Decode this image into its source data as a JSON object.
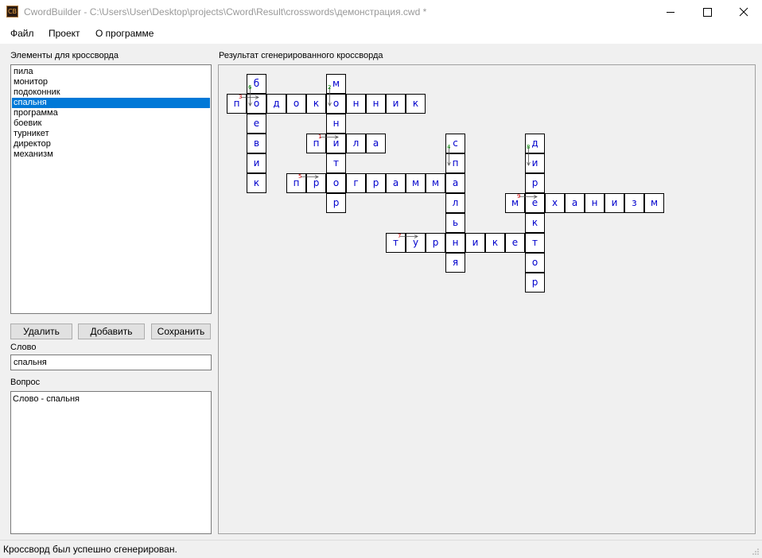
{
  "window": {
    "icon_text": "CB",
    "title": "CwordBuilder - C:\\Users\\User\\Desktop\\projects\\Cword\\Result\\crosswords\\демонстрация.cwd *"
  },
  "menu": [
    "Файл",
    "Проект",
    "О программе"
  ],
  "left_panel": {
    "elements_label": "Элементы для кроссворда",
    "elements": [
      "пила",
      "монитор",
      "подоконник",
      "спальня",
      "программа",
      "боевик",
      "турникет",
      "директор",
      "механизм"
    ],
    "selected_element": "спальня",
    "buttons": {
      "delete": "Удалить",
      "add": "Добавить",
      "save": "Сохранить"
    },
    "word_label": "Слово",
    "word_value": "спальня",
    "question_label": "Вопрос",
    "question_value": "Слово - спальня"
  },
  "right_panel": {
    "result_label": "Результат сгенерированного кроссворда"
  },
  "crossword": {
    "colors": {
      "letter": "#0000cc",
      "across_number": "#cc0000",
      "down_number": "#008800",
      "arrow": "#555555"
    },
    "words": [
      {
        "number": "1",
        "word": "пила",
        "direction": "across",
        "row": 3,
        "col": 4
      },
      {
        "number": "2",
        "word": "монитор",
        "direction": "down",
        "row": 0,
        "col": 5
      },
      {
        "number": "3",
        "word": "подоконник",
        "direction": "across",
        "row": 1,
        "col": 0
      },
      {
        "number": "4",
        "word": "спальня",
        "direction": "down",
        "row": 3,
        "col": 11
      },
      {
        "number": "5",
        "word": "программа",
        "direction": "across",
        "row": 5,
        "col": 3
      },
      {
        "number": "6",
        "word": "боевик",
        "direction": "down",
        "row": 0,
        "col": 1
      },
      {
        "number": "7",
        "word": "турникет",
        "direction": "across",
        "row": 8,
        "col": 8
      },
      {
        "number": "8",
        "word": "директор",
        "direction": "down",
        "row": 3,
        "col": 15
      },
      {
        "number": "9",
        "word": "механизм",
        "direction": "across",
        "row": 6,
        "col": 14
      }
    ]
  },
  "status": {
    "message": "Кроссворд был успешно сгенерирован."
  }
}
